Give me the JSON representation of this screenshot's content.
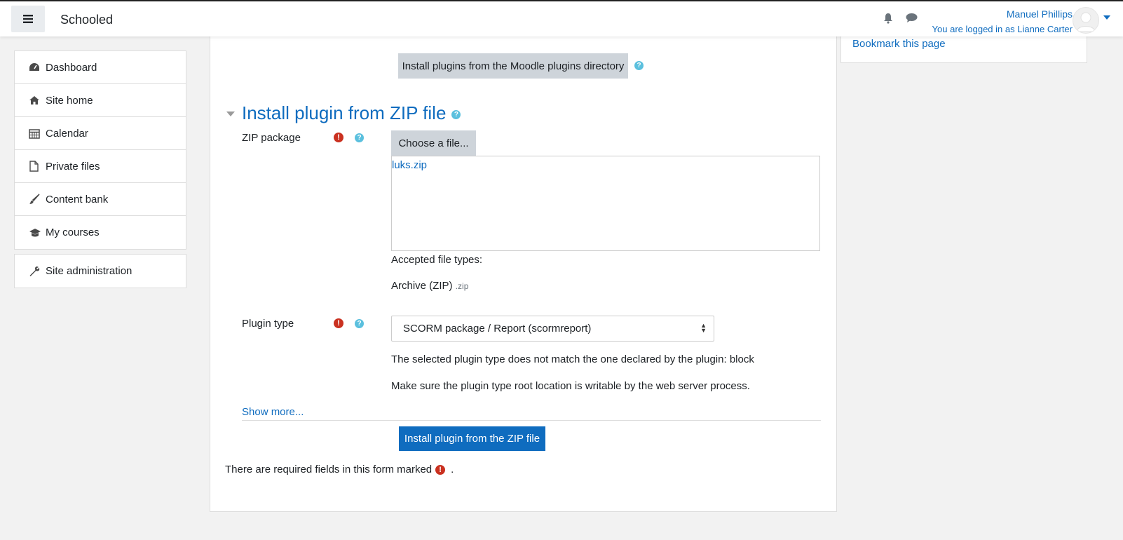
{
  "navbar": {
    "brand": "Schooled",
    "user_name": "Manuel Phillips",
    "logged_in_as": "You are logged in as Lianne Carter"
  },
  "sidebar": {
    "items": [
      {
        "label": "Dashboard",
        "icon": "dashboard-icon"
      },
      {
        "label": "Site home",
        "icon": "home-icon"
      },
      {
        "label": "Calendar",
        "icon": "calendar-icon"
      },
      {
        "label": "Private files",
        "icon": "file-icon"
      },
      {
        "label": "Content bank",
        "icon": "paint-brush-icon"
      },
      {
        "label": "My courses",
        "icon": "graduation-cap-icon"
      }
    ],
    "admin": {
      "label": "Site administration",
      "icon": "wrench-icon"
    }
  },
  "main": {
    "install_directory_button": "Install plugins from the Moodle plugins directory",
    "section_title": "Install plugin from ZIP file",
    "zip_label": "ZIP package",
    "choose_file_button": "Choose a file...",
    "selected_file": "luks.zip",
    "accepted_types_label": "Accepted file types:",
    "accepted_type": "Archive (ZIP)",
    "accepted_ext": ".zip",
    "plugin_type_label": "Plugin type",
    "plugin_type_value": "SCORM package / Report (scormreport)",
    "warning_1": "The selected plugin type does not match the one declared by the plugin: block",
    "warning_2": "Make sure the plugin type root location is writable by the web server process.",
    "show_more": "Show more...",
    "install_zip_button": "Install plugin from the ZIP file",
    "required_note": "There are required fields in this form marked",
    "required_note_end": "."
  },
  "right_block": {
    "bookmark": "Bookmark this page"
  },
  "colors": {
    "link": "#0f6cbf",
    "primary": "#0f6cbf",
    "required": "#ca3120",
    "help": "#5bc0de"
  }
}
